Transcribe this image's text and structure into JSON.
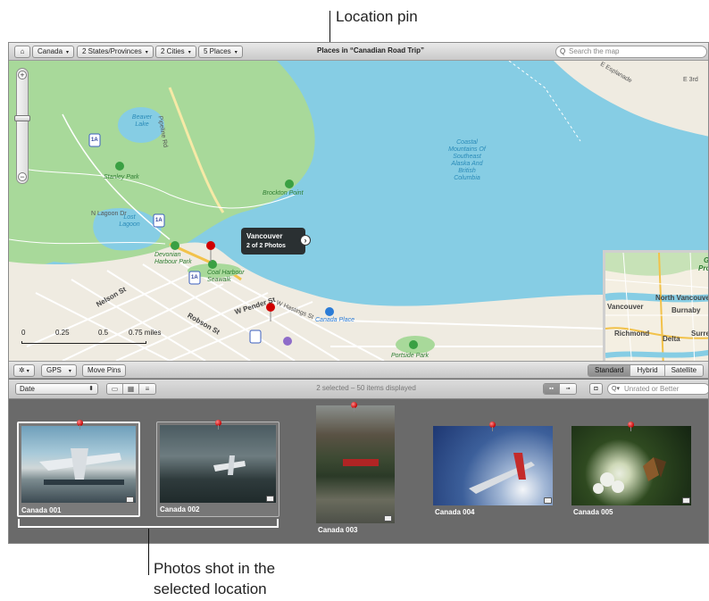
{
  "callouts": {
    "location_pin": "Location pin",
    "photos_line1": "Photos shot in the",
    "photos_line2": "selected location"
  },
  "topbar": {
    "home_icon": "house-icon",
    "crumbs": [
      {
        "label": "Canada",
        "arrow": "▾"
      },
      {
        "label": "2 States/Provinces",
        "arrow": "▾"
      },
      {
        "label": "2 Cities",
        "arrow": "▾"
      },
      {
        "label": "5 Places",
        "arrow": "▾"
      }
    ],
    "title": "Places in “Canadian Road Trip”",
    "search_placeholder": "Search the map"
  },
  "map": {
    "zoom_in": "+",
    "zoom_out": "−",
    "scale": {
      "labels": [
        "0",
        "0.25",
        "0.5",
        "0.75 miles"
      ]
    },
    "callout": {
      "title": "Vancouver",
      "subtitle": "2 of 2 Photos",
      "disclosure": "›"
    },
    "labels": {
      "beaver_lake": "Beaver Lake",
      "stanley_park": "Stanley Park",
      "brockton_point": "Brockton Point",
      "lost_lagoon": "Lost Lagoon",
      "devonian": "Devonian Harbour Park",
      "coal_harbour": "Coal Harbour Seawalk",
      "coastal_mountains": "Coastal Mountains Of Southeast Alaska And British Columbia",
      "canada_place": "Canada Place",
      "portside": "Portside Park",
      "e_esplanade": "E Esplanade",
      "e_3rd": "E 3rd",
      "robson": "Robson St",
      "w_pender": "W Pender St",
      "w_hastings": "W Hastings St",
      "nelson": "Nelson St",
      "pipeline": "Pipeline Rd",
      "n_lagoon": "N Lagoon Dr",
      "hwy": "1A"
    },
    "inset": {
      "north_vancouver": "North Vancouver",
      "vancouver": "Vancouver",
      "burnaby": "Burnaby",
      "richmond": "Richmond",
      "delta": "Delta",
      "surrey": "Surrey",
      "g": "G",
      "pro": "Pro"
    }
  },
  "toolbar2": {
    "gear": "✲",
    "gear_arrow": "▾",
    "gps": "GPS",
    "gps_arrow": "▾",
    "move_pins": "Move Pins",
    "map_types": [
      "Standard",
      "Hybrid",
      "Satellite"
    ],
    "map_type_selected": "Standard"
  },
  "toolbar3": {
    "sort": "Date",
    "sort_arrow": "⬍",
    "status": "2 selected – 50 items displayed",
    "filter_placeholder": "Unrated or Better",
    "filter_icon": "Q▾"
  },
  "photos": [
    {
      "name": "Canada 001",
      "selected": true
    },
    {
      "name": "Canada 002",
      "selected": true
    },
    {
      "name": "Canada 003",
      "selected": false
    },
    {
      "name": "Canada 004",
      "selected": false
    },
    {
      "name": "Canada 005",
      "selected": false
    }
  ],
  "colors": {
    "water": "#86cde4",
    "park": "#a8d99a",
    "land": "#f1ede3",
    "pin": "#d00000",
    "browser_bg": "#6a6a6a"
  }
}
